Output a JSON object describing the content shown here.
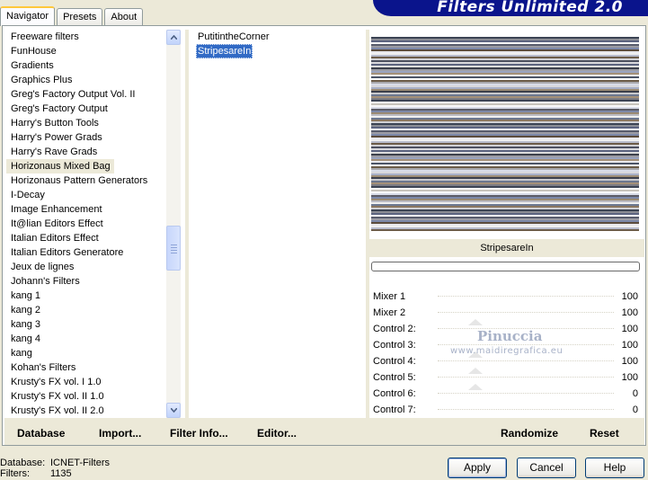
{
  "tabs": [
    {
      "label": "Navigator"
    },
    {
      "label": "Presets"
    },
    {
      "label": "About"
    }
  ],
  "banner": {
    "title": "Filters Unlimited 2.0"
  },
  "categories": {
    "items": [
      "Freeware filters",
      "FunHouse",
      "Gradients",
      "Graphics Plus",
      "Greg's Factory Output Vol. II",
      "Greg's Factory Output",
      "Harry's Button Tools",
      "Harry's Power Grads",
      "Harry's Rave Grads",
      "Horizonaus Mixed Bag",
      "Horizonaus Pattern Generators",
      "I-Decay",
      "Image Enhancement",
      "It@lian Editors Effect",
      "Italian Editors Effect",
      "Italian Editors Generatore",
      "Jeux de lignes",
      "Johann's Filters",
      "kang 1",
      "kang 2",
      "kang 3",
      "kang 4",
      "kang",
      "Kohan's Filters",
      "Krusty's FX vol. I 1.0",
      "Krusty's FX vol. II 1.0",
      "Krusty's FX vol. II 2.0"
    ],
    "selected_index": 9
  },
  "filters": {
    "items": [
      "PutitintheCorner",
      "StripesareIn"
    ],
    "selected_index": 1
  },
  "preview": {
    "stripes": [
      "#3c4454",
      "#4c5466",
      "#f0f0f0",
      "#c8c8cc",
      "#9c9ca4",
      "#5c5c66",
      "#d8d8dc",
      "#8a8c94",
      "#fafafa",
      "#b8bccc",
      "#6c7890",
      "#9aa4c0",
      "#7c88a8",
      "#a8b0c8",
      "#5c6480",
      "#c8c4bc",
      "#6c5c48",
      "#8c7860",
      "#a49078",
      "#5c4c3c",
      "#9c8c74",
      "#dcdcdc",
      "#f8f8f8",
      "#a8a8ac",
      "#d0d0d4",
      "#7c7c84",
      "#e8e8ec",
      "#bcbcc4",
      "#3c404c",
      "#585c6c",
      "#d8dce8",
      "#4c5060"
    ]
  },
  "selected_filter_name": "StripesareIn",
  "controls": [
    {
      "label": "Mixer 1",
      "value": "100"
    },
    {
      "label": "Mixer 2",
      "value": "100"
    },
    {
      "label": "Control 2:",
      "value": "100"
    },
    {
      "label": "Control 3:",
      "value": "100"
    },
    {
      "label": "Control 4:",
      "value": "100"
    },
    {
      "label": "Control 5:",
      "value": "100"
    },
    {
      "label": "Control 6:",
      "value": "0"
    },
    {
      "label": "Control 7:",
      "value": "0"
    }
  ],
  "watermark": {
    "line1": "Pinuccia",
    "line2": "www.maidiregrafica.eu"
  },
  "toolbar": {
    "database": "Database",
    "import": "Import...",
    "filter_info": "Filter Info...",
    "editor": "Editor...",
    "randomize": "Randomize",
    "reset": "Reset"
  },
  "status": {
    "database_label": "Database:",
    "database_value": "ICNET-Filters",
    "filters_label": "Filters:",
    "filters_value": "1135"
  },
  "buttons": {
    "apply": "Apply",
    "cancel": "Cancel",
    "help": "Help"
  }
}
